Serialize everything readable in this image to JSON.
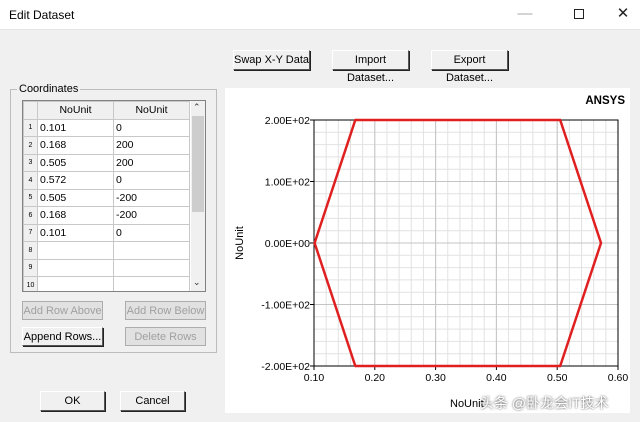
{
  "window": {
    "title": "Edit Dataset"
  },
  "toolbar": {
    "swap_label": "Swap X-Y Data",
    "import_label": "Import Dataset...",
    "export_label": "Export Dataset..."
  },
  "coordinates": {
    "group_label": "Coordinates",
    "columns": [
      "NoUnit",
      "NoUnit"
    ],
    "rows": [
      {
        "n": "1",
        "x": "0.101",
        "y": "0"
      },
      {
        "n": "2",
        "x": "0.168",
        "y": "200"
      },
      {
        "n": "3",
        "x": "0.505",
        "y": "200"
      },
      {
        "n": "4",
        "x": "0.572",
        "y": "0"
      },
      {
        "n": "5",
        "x": "0.505",
        "y": "-200"
      },
      {
        "n": "6",
        "x": "0.168",
        "y": "-200"
      },
      {
        "n": "7",
        "x": "0.101",
        "y": "0"
      },
      {
        "n": "8",
        "x": "",
        "y": ""
      },
      {
        "n": "9",
        "x": "",
        "y": ""
      },
      {
        "n": "10",
        "x": "",
        "y": ""
      }
    ],
    "add_above_label": "Add Row Above",
    "add_below_label": "Add Row Below",
    "append_label": "Append Rows...",
    "delete_label": "Delete Rows"
  },
  "footer": {
    "ok_label": "OK",
    "cancel_label": "Cancel"
  },
  "chart_data": {
    "type": "line",
    "brand": "ANSYS",
    "title": "",
    "xlabel": "NoUnit",
    "ylabel": "NoUnit",
    "xlim": [
      0.1,
      0.6
    ],
    "ylim": [
      -200,
      200
    ],
    "xticks": [
      "0.10",
      "0.20",
      "0.30",
      "0.40",
      "0.50",
      "0.60"
    ],
    "yticks": [
      "2.00E+02",
      "1.00E+02",
      "0.00E+00",
      "-1.00E+02",
      "-2.00E+02"
    ],
    "grid": true,
    "line_color": "#e02020",
    "points": [
      [
        0.101,
        0
      ],
      [
        0.168,
        200
      ],
      [
        0.505,
        200
      ],
      [
        0.572,
        0
      ],
      [
        0.505,
        -200
      ],
      [
        0.168,
        -200
      ],
      [
        0.101,
        0
      ]
    ]
  },
  "watermark": "头条 @卧龙会IT技术"
}
